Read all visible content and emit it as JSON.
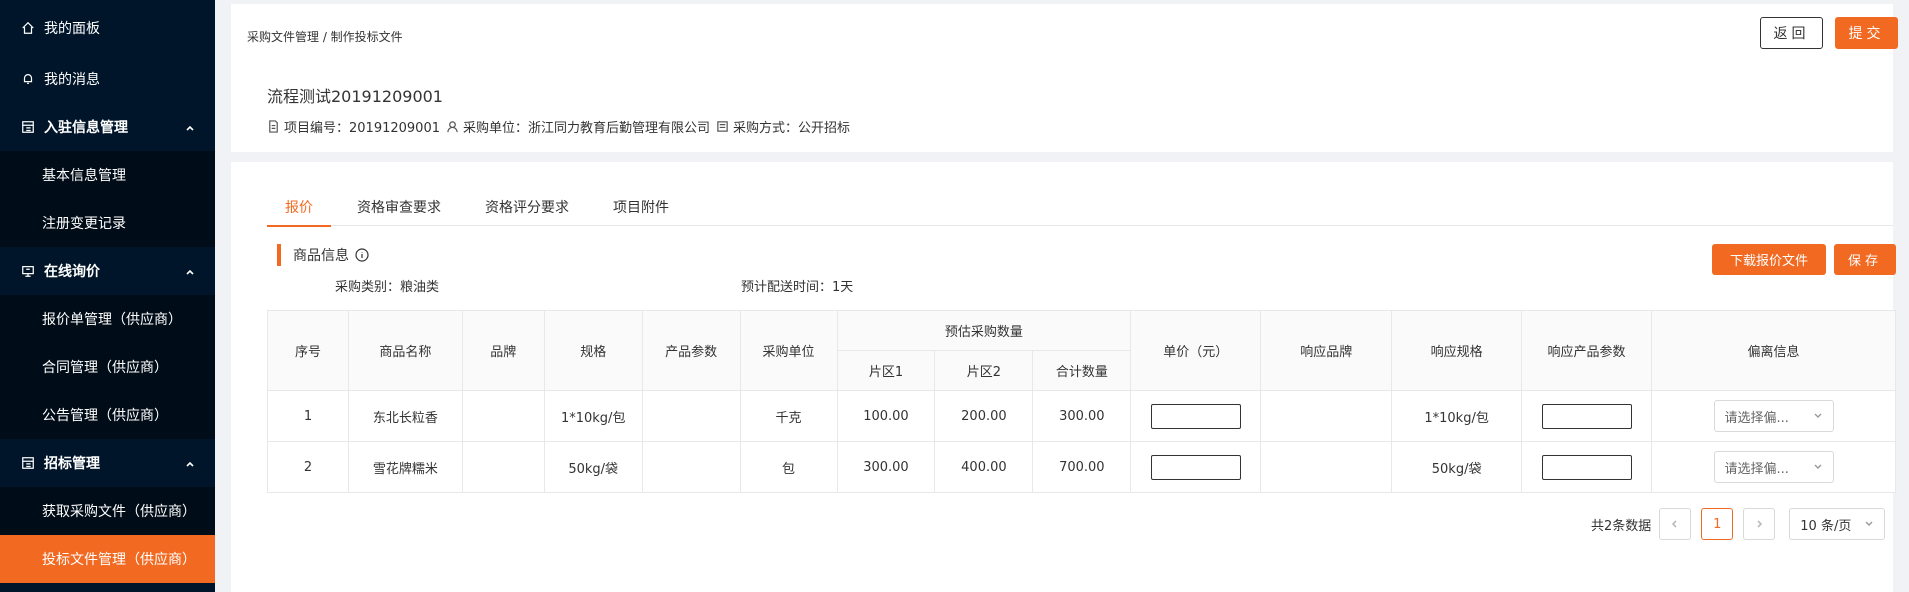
{
  "sidebar": {
    "dashboard": "我的面板",
    "messages": "我的消息",
    "groups": [
      {
        "label": "入驻信息管理",
        "items": [
          "基本信息管理",
          "注册变更记录"
        ]
      },
      {
        "label": "在线询价",
        "items": [
          "报价单管理（供应商）",
          "合同管理（供应商）",
          "公告管理（供应商）"
        ]
      },
      {
        "label": "招标管理",
        "items": [
          "获取采购文件（供应商）",
          "投标文件管理（供应商）"
        ]
      }
    ],
    "active_item": "投标文件管理（供应商）"
  },
  "header": {
    "breadcrumb": "采购文件管理 / 制作投标文件",
    "back_label": "返回",
    "submit_label": "提交",
    "project_title": "流程测试20191209001",
    "project_no": "项目编号：20191209001",
    "purchase_unit": "采购单位：浙江同力教育后勤管理有限公司",
    "purchase_method": "采购方式：公开招标"
  },
  "tabs": [
    "报价",
    "资格审查要求",
    "资格评分要求",
    "项目附件"
  ],
  "section": {
    "title": "商品信息",
    "download_label": "下载报价文件",
    "save_label": "保存",
    "category": "采购类别：粮油类",
    "delivery": "预计配送时间：1天"
  },
  "table": {
    "headers": {
      "seq": "序号",
      "name": "商品名称",
      "brand": "品牌",
      "spec": "规格",
      "params": "产品参数",
      "unit": "采购单位",
      "est_qty": "预估采购数量",
      "zone1": "片区1",
      "zone2": "片区2",
      "total": "合计数量",
      "price": "单价（元）",
      "resp_brand": "响应品牌",
      "resp_spec": "响应规格",
      "resp_params": "响应产品参数",
      "deviation": "偏离信息"
    },
    "rows": [
      {
        "seq": "1",
        "name": "东北长粒香",
        "brand": "",
        "spec": "1*10kg/包",
        "params": "",
        "unit": "千克",
        "zone1": "100.00",
        "zone2": "200.00",
        "total": "300.00",
        "resp_brand": "",
        "resp_spec": "1*10kg/包",
        "deviation_placeholder": "请选择偏..."
      },
      {
        "seq": "2",
        "name": "雪花牌糯米",
        "brand": "",
        "spec": "50kg/袋",
        "params": "",
        "unit": "包",
        "zone1": "300.00",
        "zone2": "400.00",
        "total": "700.00",
        "resp_brand": "",
        "resp_spec": "50kg/袋",
        "deviation_placeholder": "请选择偏..."
      }
    ]
  },
  "pagination": {
    "total": "共2条数据",
    "current": "1",
    "page_size": "10 条/页"
  },
  "colors": {
    "accent": "#f26a22",
    "sidebar_bg": "#001529",
    "submenu_bg": "#000c17"
  }
}
